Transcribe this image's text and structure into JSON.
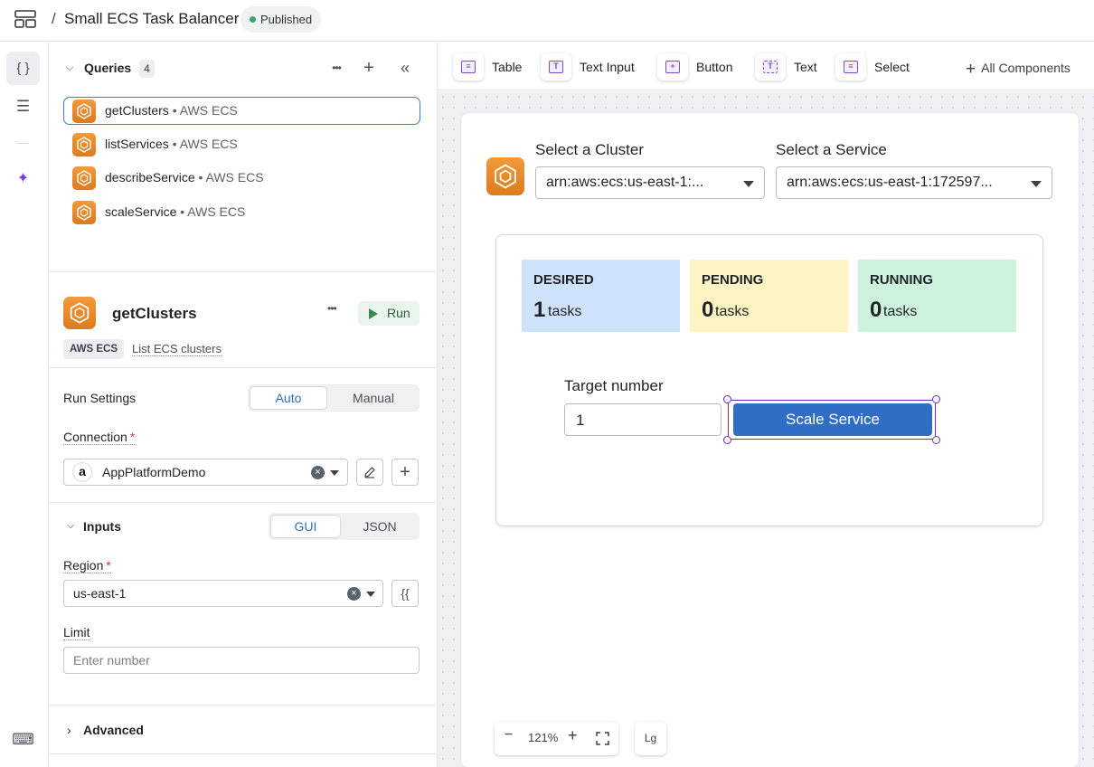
{
  "header": {
    "separator": "/",
    "title": "Small ECS Task Balancer",
    "status": "Published",
    "status_color": "#3aa76d"
  },
  "rail": {
    "items": [
      {
        "icon": "code-braces-icon",
        "glyph": "{ }",
        "active": true
      },
      {
        "icon": "list-icon",
        "glyph": "☰",
        "active": false
      },
      {
        "icon": "sparkle-icon",
        "glyph": "✦",
        "active": false
      },
      {
        "icon": "keyboard-icon",
        "glyph": "⌨",
        "active": false
      }
    ]
  },
  "queries": {
    "label": "Queries",
    "count": "4",
    "more": "•••",
    "add": "+",
    "collapse": "«",
    "items": [
      {
        "name": "getClusters",
        "source": " • AWS ECS",
        "selected": true
      },
      {
        "name": "listServices",
        "source": " • AWS ECS",
        "selected": false
      },
      {
        "name": "describeService",
        "source": " • AWS ECS",
        "selected": false
      },
      {
        "name": "scaleService",
        "source": " • AWS ECS",
        "selected": false
      }
    ]
  },
  "editor": {
    "query_name": "getClusters",
    "more": "•••",
    "run_label": "Run",
    "tag": "AWS ECS",
    "description": "List ECS clusters",
    "run_settings": {
      "label": "Run Settings",
      "options": [
        "Auto",
        "Manual"
      ],
      "selected": "Auto"
    },
    "connection": {
      "label": "Connection",
      "required": "*",
      "value": "AppPlatformDemo",
      "logo": "a"
    },
    "inputs": {
      "label": "Inputs",
      "options": [
        "GUI",
        "JSON"
      ],
      "selected": "GUI"
    },
    "region": {
      "label": "Region",
      "required": "*",
      "value": "us-east-1",
      "expr_button": "{{"
    },
    "limit": {
      "label": "Limit",
      "placeholder": "Enter number"
    },
    "advanced": {
      "label": "Advanced"
    }
  },
  "toolbar": {
    "components": [
      {
        "label": "Table",
        "icon": "table-icon",
        "glyph": "≡"
      },
      {
        "label": "Text Input",
        "icon": "text-input-icon",
        "glyph": "T"
      },
      {
        "label": "Button",
        "icon": "button-icon",
        "glyph": "+"
      },
      {
        "label": "Text",
        "icon": "text-icon",
        "glyph": "T"
      },
      {
        "label": "Select",
        "icon": "select-icon",
        "glyph": "≡"
      }
    ],
    "all_components": "All Components"
  },
  "canvas": {
    "cluster": {
      "label": "Select a Cluster",
      "value": "arn:aws:ecs:us-east-1:..."
    },
    "service": {
      "label": "Select a Service",
      "value": "arn:aws:ecs:us-east-1:172597..."
    },
    "stats": [
      {
        "label": "DESIRED",
        "value": "1",
        "unit": "tasks",
        "color": "#cfe2fb"
      },
      {
        "label": "PENDING",
        "value": "0",
        "unit": "tasks",
        "color": "#fdf4c3"
      },
      {
        "label": "RUNNING",
        "value": "0",
        "unit": "tasks",
        "color": "#cdf3df"
      }
    ],
    "target": {
      "label": "Target number",
      "value": "1"
    },
    "scale_button": "Scale Service",
    "zoom": {
      "minus": "−",
      "level": "121%",
      "plus": "+"
    },
    "size_button": "Lg"
  }
}
